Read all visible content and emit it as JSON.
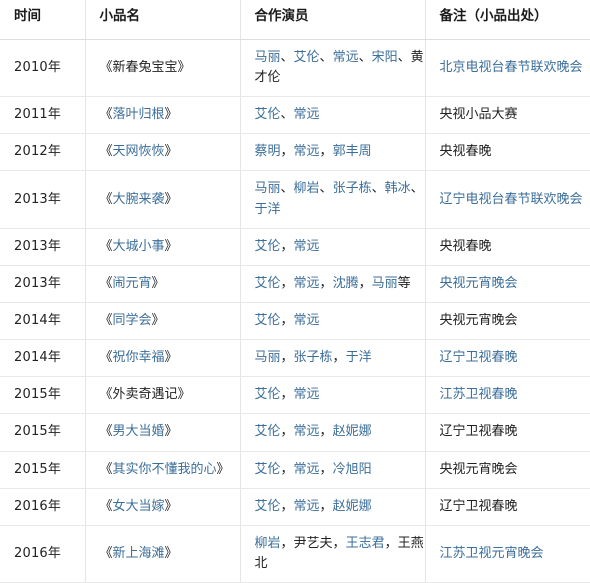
{
  "table": {
    "headers": [
      "时间",
      "小品名",
      "合作演员",
      "备注（小品出处）"
    ],
    "colors": {
      "link": "#3b6e9a",
      "text": "#222222",
      "border": "#e5e5e5",
      "background": "#ffffff"
    },
    "rows": [
      {
        "time": "2010年",
        "name": [
          {
            "text": "《新春兔宝宝》",
            "link": false
          }
        ],
        "actors": [
          {
            "text": "马丽",
            "link": true
          },
          {
            "text": "、",
            "link": false
          },
          {
            "text": "艾伦",
            "link": true
          },
          {
            "text": "、",
            "link": false
          },
          {
            "text": "常远",
            "link": true
          },
          {
            "text": "、",
            "link": false
          },
          {
            "text": "宋阳",
            "link": true
          },
          {
            "text": "、",
            "link": false
          },
          {
            "text": "黄才伦",
            "link": false
          }
        ],
        "remark": [
          {
            "text": "北京电视台春节联欢晚会",
            "link": true
          }
        ]
      },
      {
        "time": "2011年",
        "name": [
          {
            "text": "《",
            "link": false
          },
          {
            "text": "落叶归根",
            "link": true
          },
          {
            "text": "》",
            "link": false
          }
        ],
        "actors": [
          {
            "text": "艾伦",
            "link": true
          },
          {
            "text": "、",
            "link": false
          },
          {
            "text": "常远",
            "link": true
          }
        ],
        "remark": [
          {
            "text": "央视小品大赛",
            "link": false
          }
        ]
      },
      {
        "time": "2012年",
        "name": [
          {
            "text": "《",
            "link": false
          },
          {
            "text": "天网恢恢",
            "link": true
          },
          {
            "text": "》",
            "link": false
          }
        ],
        "actors": [
          {
            "text": "蔡明",
            "link": true
          },
          {
            "text": "，",
            "link": false
          },
          {
            "text": "常远",
            "link": true
          },
          {
            "text": "，",
            "link": false
          },
          {
            "text": "郭丰周",
            "link": true
          }
        ],
        "remark": [
          {
            "text": "央视春晚",
            "link": false
          }
        ]
      },
      {
        "time": "2013年",
        "name": [
          {
            "text": "《",
            "link": false
          },
          {
            "text": "大腕来袭",
            "link": true
          },
          {
            "text": "》",
            "link": false
          }
        ],
        "actors": [
          {
            "text": "马丽",
            "link": true
          },
          {
            "text": "、",
            "link": false
          },
          {
            "text": "柳岩",
            "link": true
          },
          {
            "text": "、",
            "link": false
          },
          {
            "text": "张子栋",
            "link": true
          },
          {
            "text": "、",
            "link": false
          },
          {
            "text": "韩冰",
            "link": true
          },
          {
            "text": "、",
            "link": false
          },
          {
            "text": "于洋",
            "link": true
          }
        ],
        "remark": [
          {
            "text": "辽宁电视台春节联欢晚会",
            "link": true
          }
        ]
      },
      {
        "time": "2013年",
        "name": [
          {
            "text": "《",
            "link": false
          },
          {
            "text": "大城小事",
            "link": true
          },
          {
            "text": "》",
            "link": false
          }
        ],
        "actors": [
          {
            "text": "艾伦",
            "link": true
          },
          {
            "text": "，",
            "link": false
          },
          {
            "text": "常远",
            "link": true
          }
        ],
        "remark": [
          {
            "text": "央视春晚",
            "link": false
          }
        ]
      },
      {
        "time": "2013年",
        "name": [
          {
            "text": "《",
            "link": false
          },
          {
            "text": "闹元宵",
            "link": true
          },
          {
            "text": "》",
            "link": false
          }
        ],
        "actors": [
          {
            "text": "艾伦",
            "link": true
          },
          {
            "text": "，",
            "link": false
          },
          {
            "text": "常远",
            "link": true
          },
          {
            "text": "，",
            "link": false
          },
          {
            "text": "沈腾",
            "link": true
          },
          {
            "text": "，",
            "link": false
          },
          {
            "text": "马丽",
            "link": true
          },
          {
            "text": "等",
            "link": false
          }
        ],
        "remark": [
          {
            "text": "央视元宵晚会",
            "link": true
          }
        ]
      },
      {
        "time": "2014年",
        "name": [
          {
            "text": "《",
            "link": false
          },
          {
            "text": "同学会",
            "link": true
          },
          {
            "text": "》",
            "link": false
          }
        ],
        "actors": [
          {
            "text": "艾伦",
            "link": true
          },
          {
            "text": "，",
            "link": false
          },
          {
            "text": "常远",
            "link": true
          }
        ],
        "remark": [
          {
            "text": "央视元宵晚会",
            "link": false
          }
        ]
      },
      {
        "time": "2014年",
        "name": [
          {
            "text": "《",
            "link": false
          },
          {
            "text": "祝你幸福",
            "link": true
          },
          {
            "text": "》",
            "link": false
          }
        ],
        "actors": [
          {
            "text": "马丽",
            "link": true
          },
          {
            "text": "，",
            "link": false
          },
          {
            "text": "张子栋",
            "link": true
          },
          {
            "text": "，",
            "link": false
          },
          {
            "text": "于洋",
            "link": true
          }
        ],
        "remark": [
          {
            "text": "辽宁卫视春晚",
            "link": true
          }
        ]
      },
      {
        "time": "2015年",
        "name": [
          {
            "text": "《外卖奇遇记》",
            "link": false
          }
        ],
        "actors": [
          {
            "text": "艾伦",
            "link": true
          },
          {
            "text": "，",
            "link": false
          },
          {
            "text": "常远",
            "link": true
          }
        ],
        "remark": [
          {
            "text": "江苏卫视春晚",
            "link": true
          }
        ]
      },
      {
        "time": "2015年",
        "name": [
          {
            "text": "《",
            "link": false
          },
          {
            "text": "男大当婚",
            "link": true
          },
          {
            "text": "》",
            "link": false
          }
        ],
        "actors": [
          {
            "text": "艾伦",
            "link": true
          },
          {
            "text": "，",
            "link": false
          },
          {
            "text": "常远",
            "link": true
          },
          {
            "text": "，",
            "link": false
          },
          {
            "text": "赵妮娜",
            "link": true
          }
        ],
        "remark": [
          {
            "text": "辽宁卫视春晚",
            "link": false
          }
        ]
      },
      {
        "time": "2015年",
        "name": [
          {
            "text": "《",
            "link": false
          },
          {
            "text": "其实你不懂我的心",
            "link": true
          },
          {
            "text": "》",
            "link": false
          }
        ],
        "actors": [
          {
            "text": "艾伦",
            "link": true
          },
          {
            "text": "，",
            "link": false
          },
          {
            "text": "常远",
            "link": true
          },
          {
            "text": "，",
            "link": false
          },
          {
            "text": "冷旭阳",
            "link": true
          }
        ],
        "remark": [
          {
            "text": "央视元宵晚会",
            "link": false
          }
        ]
      },
      {
        "time": "2016年",
        "name": [
          {
            "text": "《",
            "link": false
          },
          {
            "text": "女大当嫁",
            "link": true
          },
          {
            "text": "》",
            "link": false
          }
        ],
        "actors": [
          {
            "text": "艾伦",
            "link": true
          },
          {
            "text": "，",
            "link": false
          },
          {
            "text": "常远",
            "link": true
          },
          {
            "text": "，",
            "link": false
          },
          {
            "text": "赵妮娜",
            "link": true
          }
        ],
        "remark": [
          {
            "text": "辽宁卫视春晚",
            "link": false
          }
        ]
      },
      {
        "time": "2016年",
        "name": [
          {
            "text": "《",
            "link": false
          },
          {
            "text": "新上海滩",
            "link": true
          },
          {
            "text": "》",
            "link": false
          }
        ],
        "actors": [
          {
            "text": "柳岩",
            "link": true
          },
          {
            "text": "，",
            "link": false
          },
          {
            "text": "尹艺夫",
            "link": false
          },
          {
            "text": "，",
            "link": false
          },
          {
            "text": "王志君",
            "link": true
          },
          {
            "text": "，",
            "link": false
          },
          {
            "text": "王燕北",
            "link": false
          }
        ],
        "remark": [
          {
            "text": "江苏卫视元宵晚会",
            "link": true
          }
        ]
      }
    ]
  }
}
